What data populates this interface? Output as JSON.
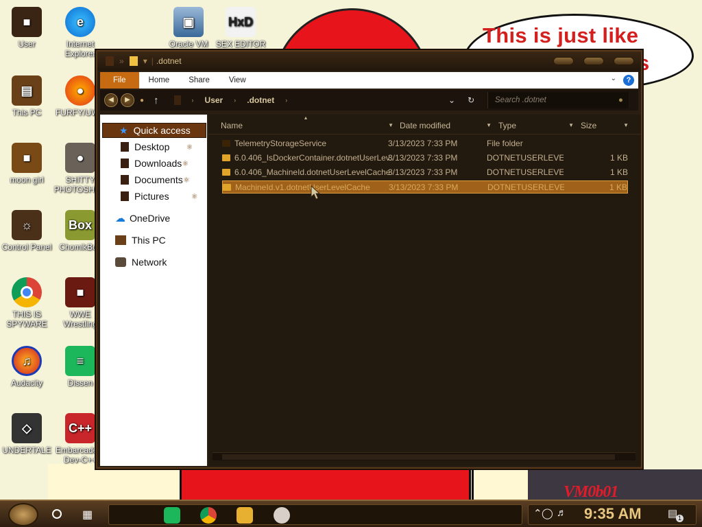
{
  "wallpaper": {
    "speech_line1": "This is just like",
    "speech_line2": "s",
    "watermark": "VM0b01"
  },
  "desktop_icons": [
    {
      "label": "User"
    },
    {
      "label": "Internet Explorer"
    },
    {
      "label": "Oracle VM"
    },
    {
      "label": "SEX EDITOR"
    },
    {
      "label": "This PC"
    },
    {
      "label": "FURFY/UWU"
    },
    {
      "label": "moon girl"
    },
    {
      "label": "SHITTY PHOTOSHOP"
    },
    {
      "label": "Control Panel"
    },
    {
      "label": "ChomikBox"
    },
    {
      "label": "THIS IS SPYWARE"
    },
    {
      "label": "WWE Wrestling"
    },
    {
      "label": "Audacity"
    },
    {
      "label": "Dissen"
    },
    {
      "label": "UNDERTALE"
    },
    {
      "label": "Embarcadero Dev-C++"
    }
  ],
  "window": {
    "title": ".dotnet",
    "ribbon_tabs": [
      "File",
      "Home",
      "Share",
      "View"
    ],
    "help": "?",
    "breadcrumb": [
      "User",
      ".dotnet"
    ],
    "search_placeholder": "Search .dotnet",
    "nav": {
      "quick_access": "Quick access",
      "pinned": [
        "Desktop",
        "Downloads",
        "Documents",
        "Pictures"
      ],
      "onedrive": "OneDrive",
      "this_pc": "This PC",
      "network": "Network"
    },
    "columns": [
      "Name",
      "Date modified",
      "Type",
      "Size"
    ],
    "files": [
      {
        "name": "TelemetryStorageService",
        "date": "3/13/2023 7:33 PM",
        "type": "File folder",
        "size": ""
      },
      {
        "name": "6.0.406_IsDockerContainer.dotnetUserLev...",
        "date": "3/13/2023 7:33 PM",
        "type": "DOTNETUSERLEVE...",
        "size": "1 KB"
      },
      {
        "name": "6.0.406_MachineId.dotnetUserLevelCache",
        "date": "3/13/2023 7:33 PM",
        "type": "DOTNETUSERLEVE...",
        "size": "1 KB"
      },
      {
        "name": "MachineId.v1.dotnetUserLevelCache",
        "date": "3/13/2023 7:33 PM",
        "type": "DOTNETUSERLEVE...",
        "size": "1 KB"
      }
    ]
  },
  "taskbar": {
    "time": "9:35 AM",
    "notification_count": "1"
  }
}
